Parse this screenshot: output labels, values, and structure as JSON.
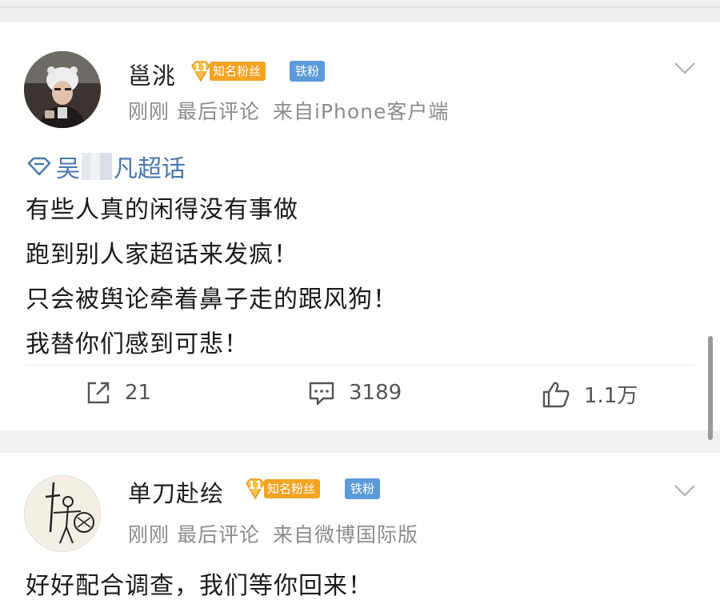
{
  "posts": [
    {
      "username": "邕洮",
      "level": "11",
      "fan_badge": "知名粉丝",
      "iron_badge": "铁粉",
      "time": "刚刚",
      "last_comment": "最后评论",
      "source": "来自iPhone客户端",
      "topic_prefix": "吴",
      "topic_suffix": "凡超话",
      "content_lines": [
        "有些人真的闲得没有事做",
        "跑到别人家超话来发疯！",
        "只会被舆论牵着鼻子走的跟风狗！",
        "我替你们感到可悲！"
      ],
      "reposts": "21",
      "comments": "3189",
      "likes": "1.1万"
    },
    {
      "username": "单刀赴绘",
      "level": "11",
      "fan_badge": "知名粉丝",
      "iron_badge": "铁粉",
      "time": "刚刚",
      "last_comment": "最后评论",
      "source": "来自微博国际版",
      "content_lines": [
        "好好配合调查，我们等你回来！"
      ]
    }
  ],
  "colors": {
    "topic": "#4a78b0",
    "fan_badge": "#f4a323",
    "iron_badge": "#5b9bd9",
    "meta": "#8c8c8c"
  },
  "icons": {
    "topic": "topic-diamond-icon",
    "repost": "repost-icon",
    "comment": "comment-icon",
    "like": "thumbs-up-icon",
    "more": "chevron-down-icon"
  }
}
